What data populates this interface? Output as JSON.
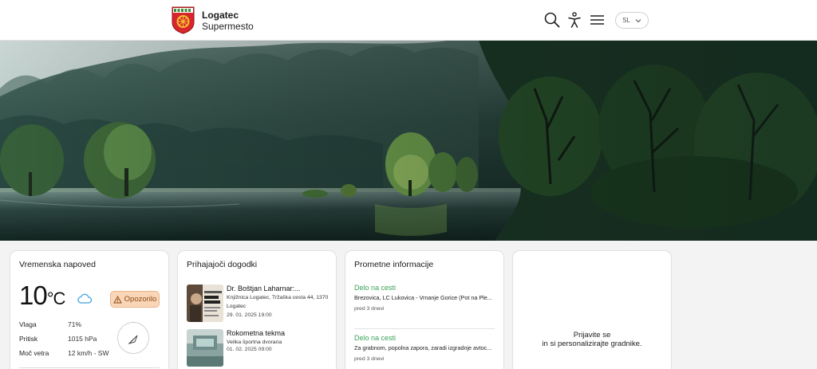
{
  "header": {
    "brand_name": "Logatec",
    "brand_tagline": "Supermesto",
    "lang": "SL",
    "icons": [
      "search-icon",
      "accessibility-icon",
      "menu-icon",
      "chevron-down-icon"
    ]
  },
  "weather": {
    "title": "Vremenska napoved",
    "temperature": "10",
    "unit": "°C",
    "condition_icon": "cloud-icon",
    "warning_label": "Opozorilo",
    "rows": [
      {
        "label": "Vlaga",
        "value": "71%"
      },
      {
        "label": "Pritisk",
        "value": "1015 hPa"
      },
      {
        "label": "Moč vetra",
        "value": "12 km/h - SW"
      }
    ]
  },
  "events": {
    "title": "Prihajajoči dogodki",
    "items": [
      {
        "title": "Dr. Boštjan Laharnar:...",
        "location": "Knjižnica Logatec, Tržaška cesta 44, 1370 Logatec",
        "date": "29. 01. 2025 19:00"
      },
      {
        "title": "Rokometna tekma",
        "location": "Velika športna dvorana",
        "date": "01. 02. 2025 09:00"
      }
    ]
  },
  "traffic": {
    "title": "Prometne informacije",
    "items": [
      {
        "kind": "Delo na cesti",
        "desc": "Brezovica, LC Lukovica - Vrnanje Gorice (Pot na Ple...",
        "time": "pred 3 dnevi"
      },
      {
        "kind": "Delo na cesti",
        "desc": "Za grabnom, popolna zapora, zaradi izgradnje avtoc...",
        "time": "pred 3 dnevi"
      }
    ]
  },
  "login_card": {
    "line1": "Prijavite se",
    "line2": "in si personalizirajte gradnike."
  },
  "colors": {
    "accent_green": "#3aa35a",
    "warning_bg": "#f9d6b8",
    "crest_red": "#d9262c",
    "crest_gold": "#f2c230"
  }
}
